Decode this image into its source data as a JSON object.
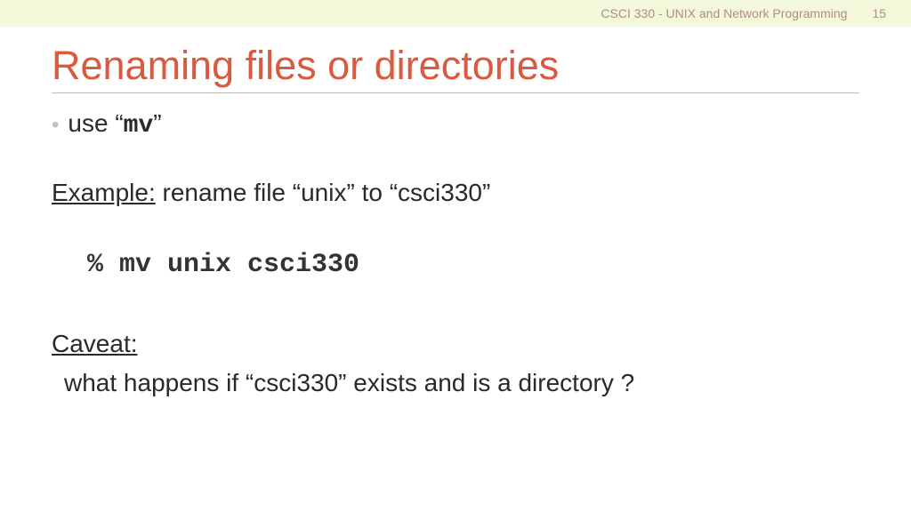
{
  "header": {
    "course": "CSCI 330 - UNIX and Network Programming",
    "slide_number": "15"
  },
  "title": "Renaming files or directories",
  "bullet": {
    "prefix": "use “",
    "command": "mv",
    "suffix": "”"
  },
  "example": {
    "label": "Example:",
    "text": " rename file “unix” to “csci330”"
  },
  "code": "% mv unix csci330",
  "caveat": {
    "label": "Caveat:",
    "text": "what happens if “csci330” exists and is a directory ?"
  }
}
